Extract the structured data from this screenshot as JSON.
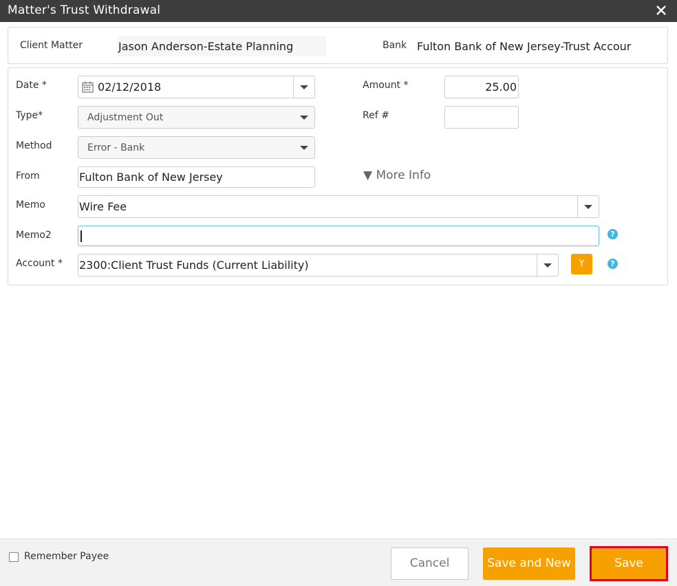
{
  "dialog": {
    "title": "Matter's Trust Withdrawal"
  },
  "header": {
    "client_matter_label": "Client Matter",
    "client_matter_value": "Jason Anderson-Estate Planning",
    "bank_label": "Bank",
    "bank_value": "Fulton Bank of New Jersey-Trust Accour"
  },
  "form": {
    "date_label": "Date *",
    "date_value": "02/12/2018",
    "amount_label": "Amount *",
    "amount_value": "25.00",
    "type_label": "Type*",
    "type_value": "Adjustment Out",
    "ref_label": "Ref #",
    "ref_value": "",
    "method_label": "Method",
    "method_value": "Error - Bank",
    "from_label": "From",
    "from_value": "Fulton Bank of New Jersey",
    "more_info": "▼ More Info",
    "memo_label": "Memo",
    "memo_value": "Wire Fee",
    "memo2_label": "Memo2",
    "memo2_value": "",
    "account_label": "Account *",
    "account_value": "2300:Client Trust Funds (Current Liability)",
    "account_button": "Y",
    "help_glyph": "?"
  },
  "footer": {
    "remember_payee_label": "Remember Payee",
    "remember_payee_checked": false,
    "cancel_label": "Cancel",
    "save_and_new_label": "Save and New",
    "save_label": "Save"
  },
  "colors": {
    "title_bar": "#3d3d3d",
    "accent": "#f7a100",
    "help": "#3cb8e3",
    "highlight_border": "#e0001b"
  },
  "icons": [
    "close-icon",
    "calendar-icon",
    "chevron-down-icon",
    "help-icon",
    "checkbox-icon"
  ]
}
